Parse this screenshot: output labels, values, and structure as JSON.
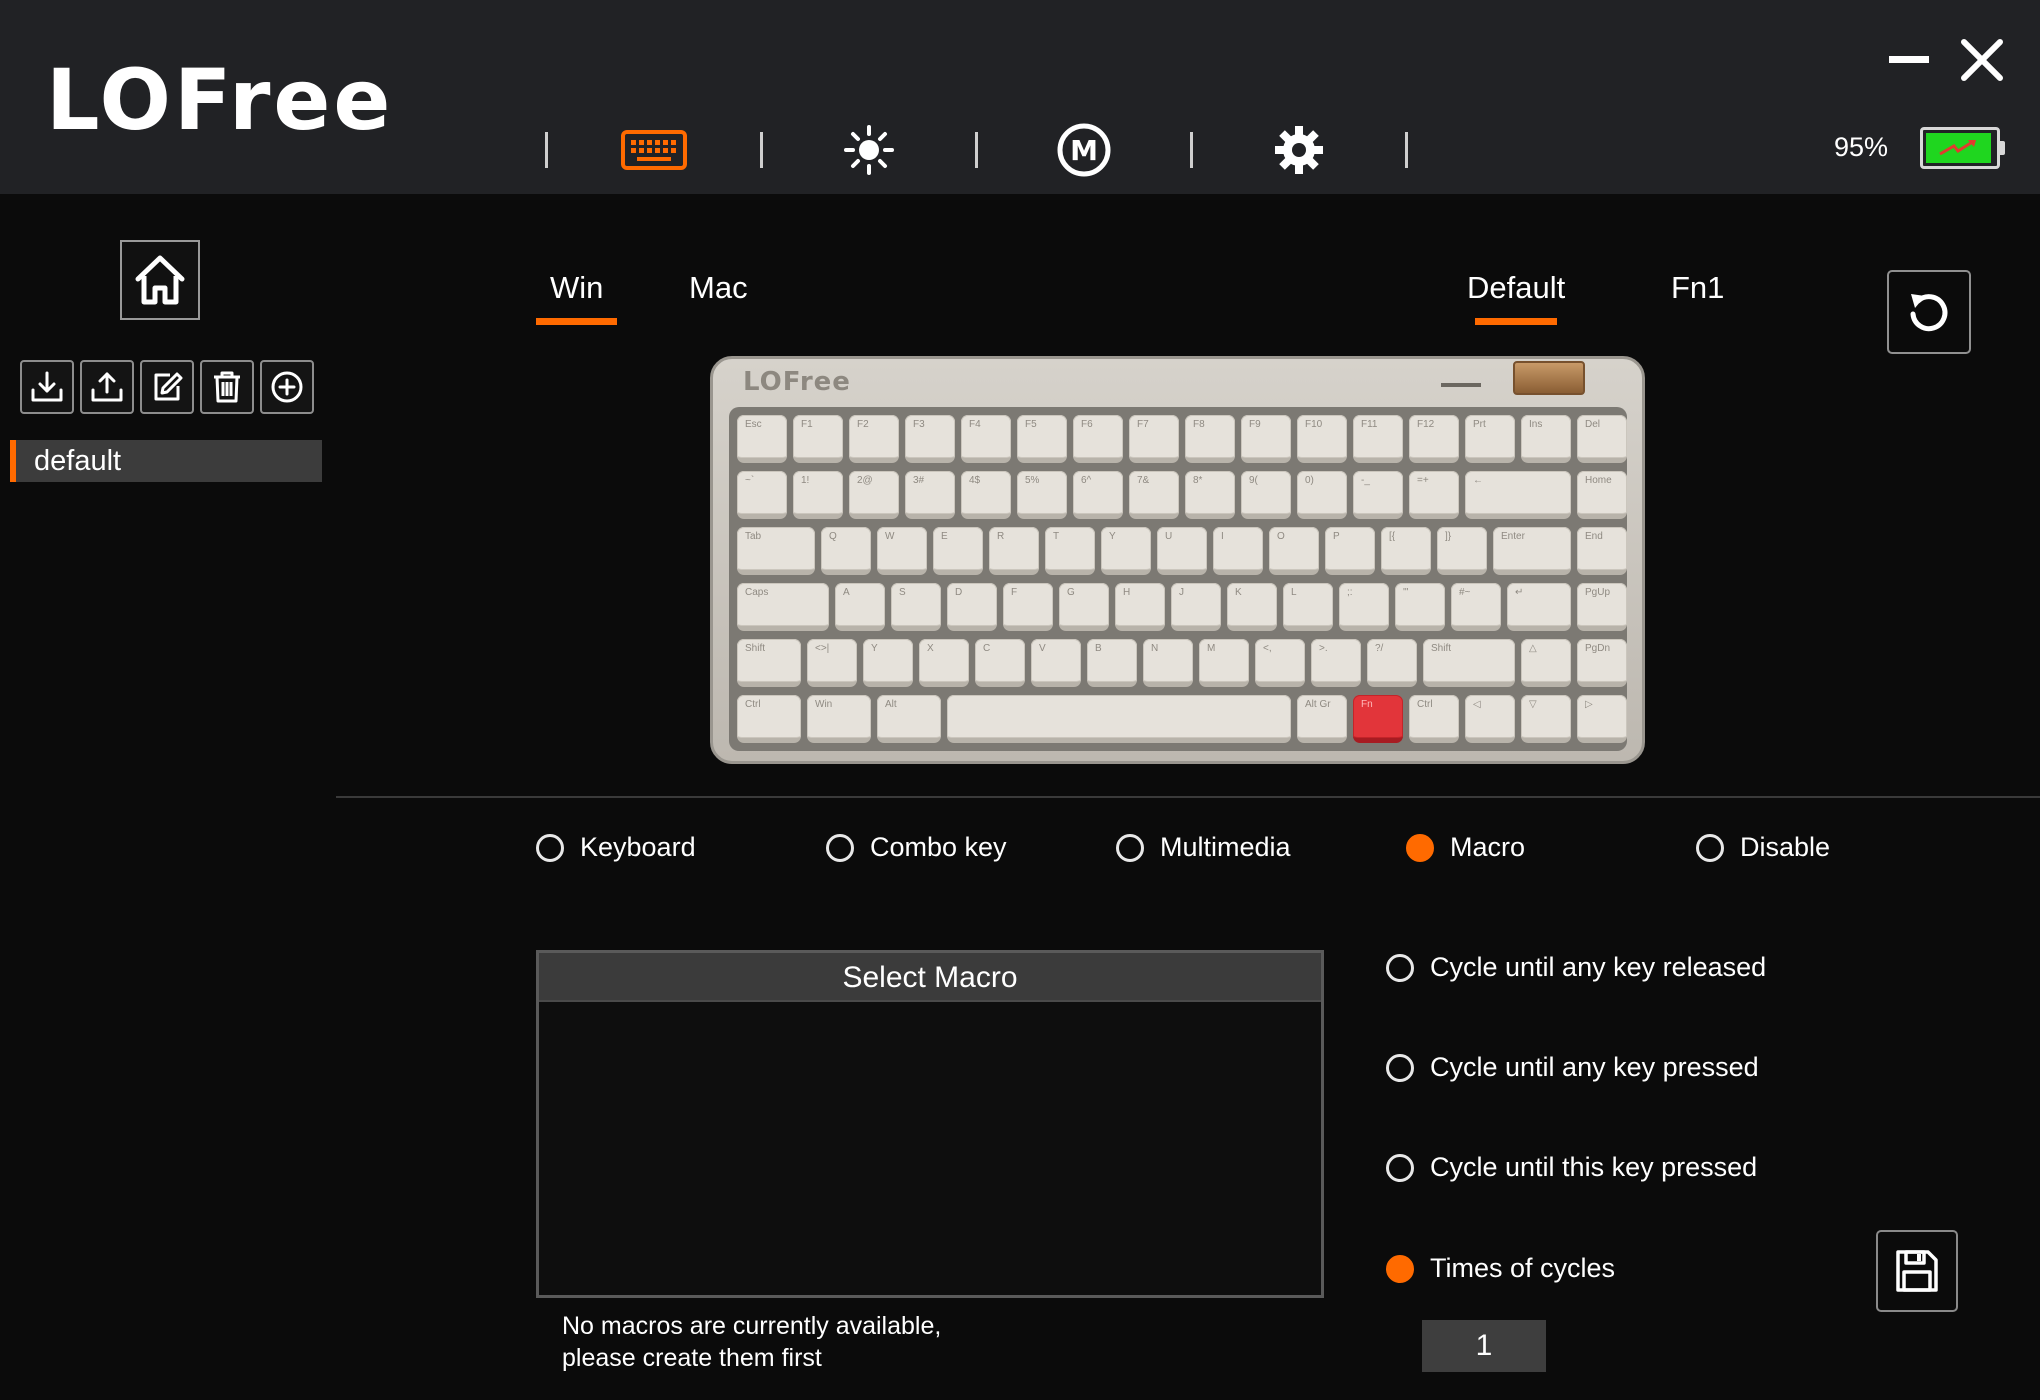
{
  "app": {
    "brand": "LOFree"
  },
  "header": {
    "nav": [
      "keyboard-icon",
      "brightness-icon",
      "macro-m-icon",
      "gear-icon"
    ],
    "active_nav": "keyboard-icon",
    "battery_text": "95%",
    "battery_level": 0.95,
    "accent_color": "#ff6a00"
  },
  "sidebar": {
    "tools": [
      "import-icon",
      "export-icon",
      "edit-icon",
      "delete-icon",
      "add-icon"
    ],
    "profiles": [
      {
        "label": "default",
        "active": true
      }
    ]
  },
  "tabs": {
    "os": [
      "Win",
      "Mac"
    ],
    "os_active": "Win",
    "layer": [
      "Default",
      "Fn1"
    ],
    "layer_active": "Default"
  },
  "keyboard": {
    "logo": "LOFree",
    "selected_key": "Fn",
    "rows": [
      [
        "Esc",
        "F1",
        "F2",
        "F3",
        "F4",
        "F5",
        "F6",
        "F7",
        "F8",
        "F9",
        "F10",
        "F11",
        "F12",
        "Prt",
        "Ins",
        "Del"
      ],
      [
        "~`",
        "1!",
        "2@",
        "3#",
        "4$",
        "5%",
        "6^",
        "7&",
        "8*",
        "9(",
        "0)",
        "-_",
        "=+",
        "←",
        "Home"
      ],
      [
        "Tab",
        "Q",
        "W",
        "E",
        "R",
        "T",
        "Y",
        "U",
        "I",
        "O",
        "P",
        "[{",
        "]}",
        "Enter",
        "End"
      ],
      [
        "Caps",
        "A",
        "S",
        "D",
        "F",
        "G",
        "H",
        "J",
        "K",
        "L",
        ";:",
        "'\"",
        "#~",
        "↵",
        "PgUp"
      ],
      [
        "Shift",
        "<>|",
        "Y",
        "X",
        "C",
        "V",
        "B",
        "N",
        "M",
        "<,",
        ">.",
        "?/",
        "Shift",
        "△",
        "PgDn"
      ],
      [
        "Ctrl",
        "Win",
        "Alt",
        "",
        "Alt Gr",
        "Fn",
        "Ctrl",
        "◁",
        "▽",
        "▷"
      ]
    ]
  },
  "key_types": {
    "options": [
      "Keyboard",
      "Combo key",
      "Multimedia",
      "Macro",
      "Disable"
    ],
    "selected": "Macro"
  },
  "macro": {
    "header": "Select Macro",
    "empty_line1": "No macros are currently available,",
    "empty_line2": "please create them first"
  },
  "cycle": {
    "options": [
      "Cycle until any key released",
      "Cycle until any key pressed",
      "Cycle until this key pressed",
      "Times of cycles"
    ],
    "selected": "Times of cycles",
    "times_value": "1"
  }
}
